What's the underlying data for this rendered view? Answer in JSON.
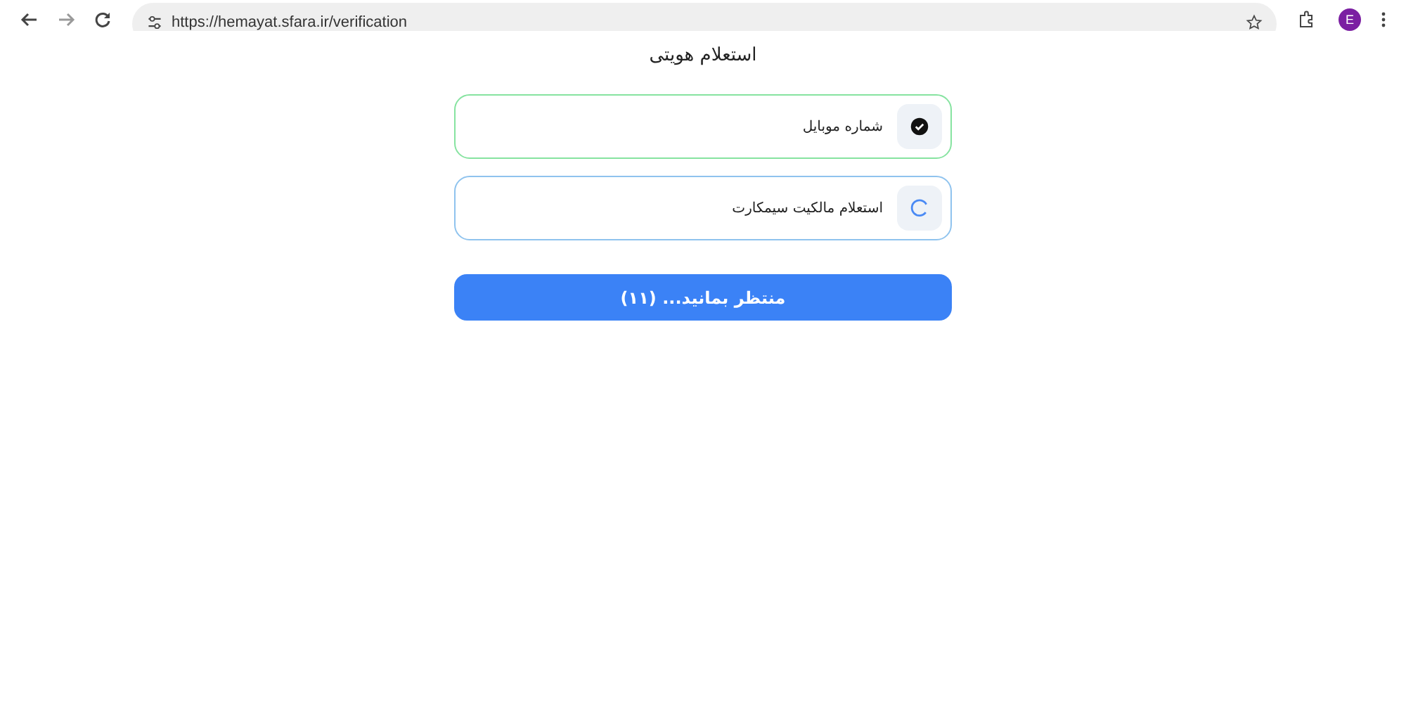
{
  "browser": {
    "url": "https://hemayat.sfara.ir/verification",
    "profile_initial": "E"
  },
  "title": "استعلام هویتی",
  "steps": [
    {
      "label": "شماره موبایل",
      "kind": "done"
    },
    {
      "label": "استعلام مالکیت سیمکارت",
      "kind": "loading"
    }
  ],
  "submit": {
    "label": "منتظر بمانید... (۱۱)"
  }
}
